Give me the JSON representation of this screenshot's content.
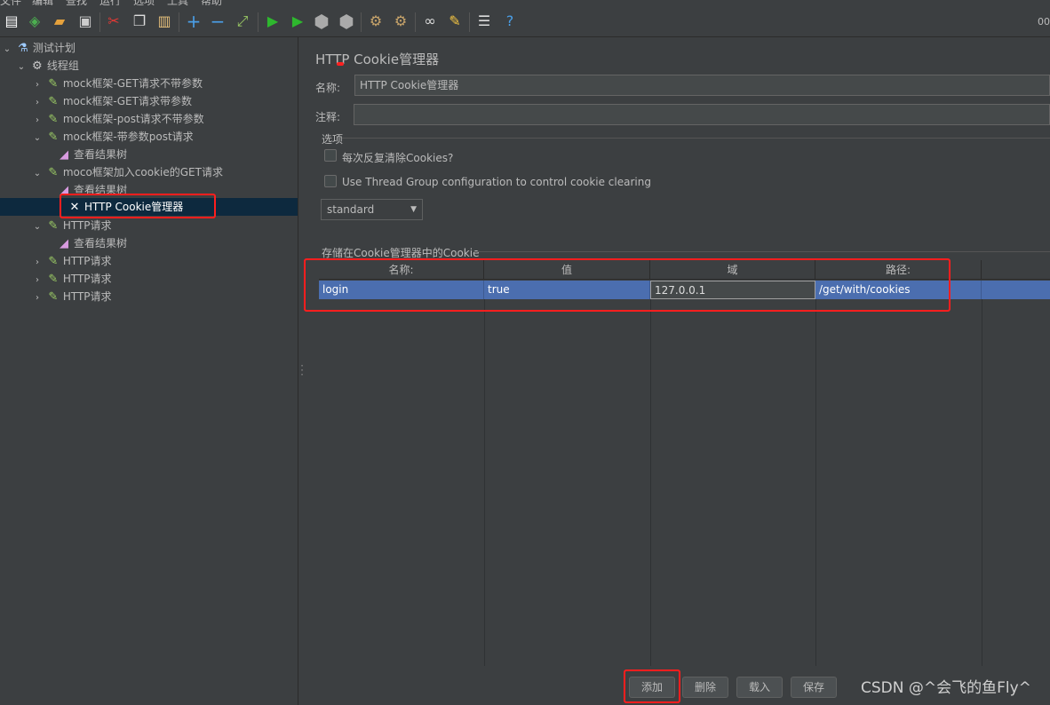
{
  "menubar": {
    "items": [
      "文件",
      "编辑",
      "查找",
      "运行",
      "选项",
      "工具",
      "帮助"
    ]
  },
  "toolbar": {
    "timer": "00",
    "icons": [
      "new-icon",
      "templates-icon",
      "open-icon",
      "save-icon",
      "cut-icon",
      "copy-icon",
      "paste-icon",
      "expand-icon",
      "collapse-icon",
      "toggle-icon",
      "start-icon",
      "start-no-pause-icon",
      "stop-icon",
      "shutdown-icon",
      "clear-icon",
      "clear-all-icon",
      "search-icon",
      "reset-search-icon",
      "function-helper-icon",
      "help-icon"
    ]
  },
  "tree": {
    "items": [
      {
        "label": "测试计划",
        "icon": "test-plan-icon",
        "arrow": "⌄",
        "level": 0
      },
      {
        "label": "线程组",
        "icon": "gear-icon",
        "arrow": "⌄",
        "level": 1
      },
      {
        "label": "mock框架-GET请求不带参数",
        "icon": "sampler-icon",
        "arrow": "›",
        "level": 2
      },
      {
        "label": "mock框架-GET请求带参数",
        "icon": "sampler-icon",
        "arrow": "›",
        "level": 2
      },
      {
        "label": "mock框架-post请求不带参数",
        "icon": "sampler-icon",
        "arrow": "›",
        "level": 2
      },
      {
        "label": "mock框架-带参数post请求",
        "icon": "sampler-icon",
        "arrow": "⌄",
        "level": 2
      },
      {
        "label": "查看结果树",
        "icon": "listener-icon",
        "arrow": "",
        "level": 3
      },
      {
        "label": "moco框架加入cookie的GET请求",
        "icon": "sampler-icon",
        "arrow": "⌄",
        "level": 2
      },
      {
        "label": "查看结果树",
        "icon": "listener-icon",
        "arrow": "",
        "level": 3
      },
      {
        "label": "HTTP Cookie管理器",
        "icon": "config-tools-icon",
        "arrow": "",
        "level": 3
      },
      {
        "label": "HTTP请求",
        "icon": "sampler-icon",
        "arrow": "⌄",
        "level": 2
      },
      {
        "label": "查看结果树",
        "icon": "listener-icon",
        "arrow": "",
        "level": 3
      },
      {
        "label": "HTTP请求",
        "icon": "sampler-icon",
        "arrow": "›",
        "level": 2
      },
      {
        "label": "HTTP请求",
        "icon": "sampler-icon",
        "arrow": "›",
        "level": 2
      },
      {
        "label": "HTTP请求",
        "icon": "sampler-icon",
        "arrow": "›",
        "level": 2
      }
    ]
  },
  "panel": {
    "title": "HTTP Cookie管理器",
    "name_label": "名称:",
    "name_value": "HTTP Cookie管理器",
    "comment_label": "注释:",
    "comment_value": "",
    "options_label": "选项",
    "clear_each_iteration_label": "每次反复清除Cookies?",
    "thread_group_config_label": "Use Thread Group configuration to control cookie clearing",
    "cookie_policy": "standard",
    "stored_cookies_label": "存储在Cookie管理器中的Cookie"
  },
  "table": {
    "headers": [
      "名称:",
      "值",
      "域",
      "路径:"
    ],
    "rows": [
      {
        "name": "login",
        "value": "true",
        "domain": "127.0.0.1",
        "path": "/get/with/cookies"
      }
    ]
  },
  "buttons": {
    "add": "添加",
    "delete": "删除",
    "load": "载入",
    "save": "保存"
  },
  "watermark": "CSDN @^会飞的鱼Fly^",
  "colors": {
    "highlight": "#ff1e1e",
    "selection": "#4b6eaf",
    "background": "#3c3f41"
  }
}
